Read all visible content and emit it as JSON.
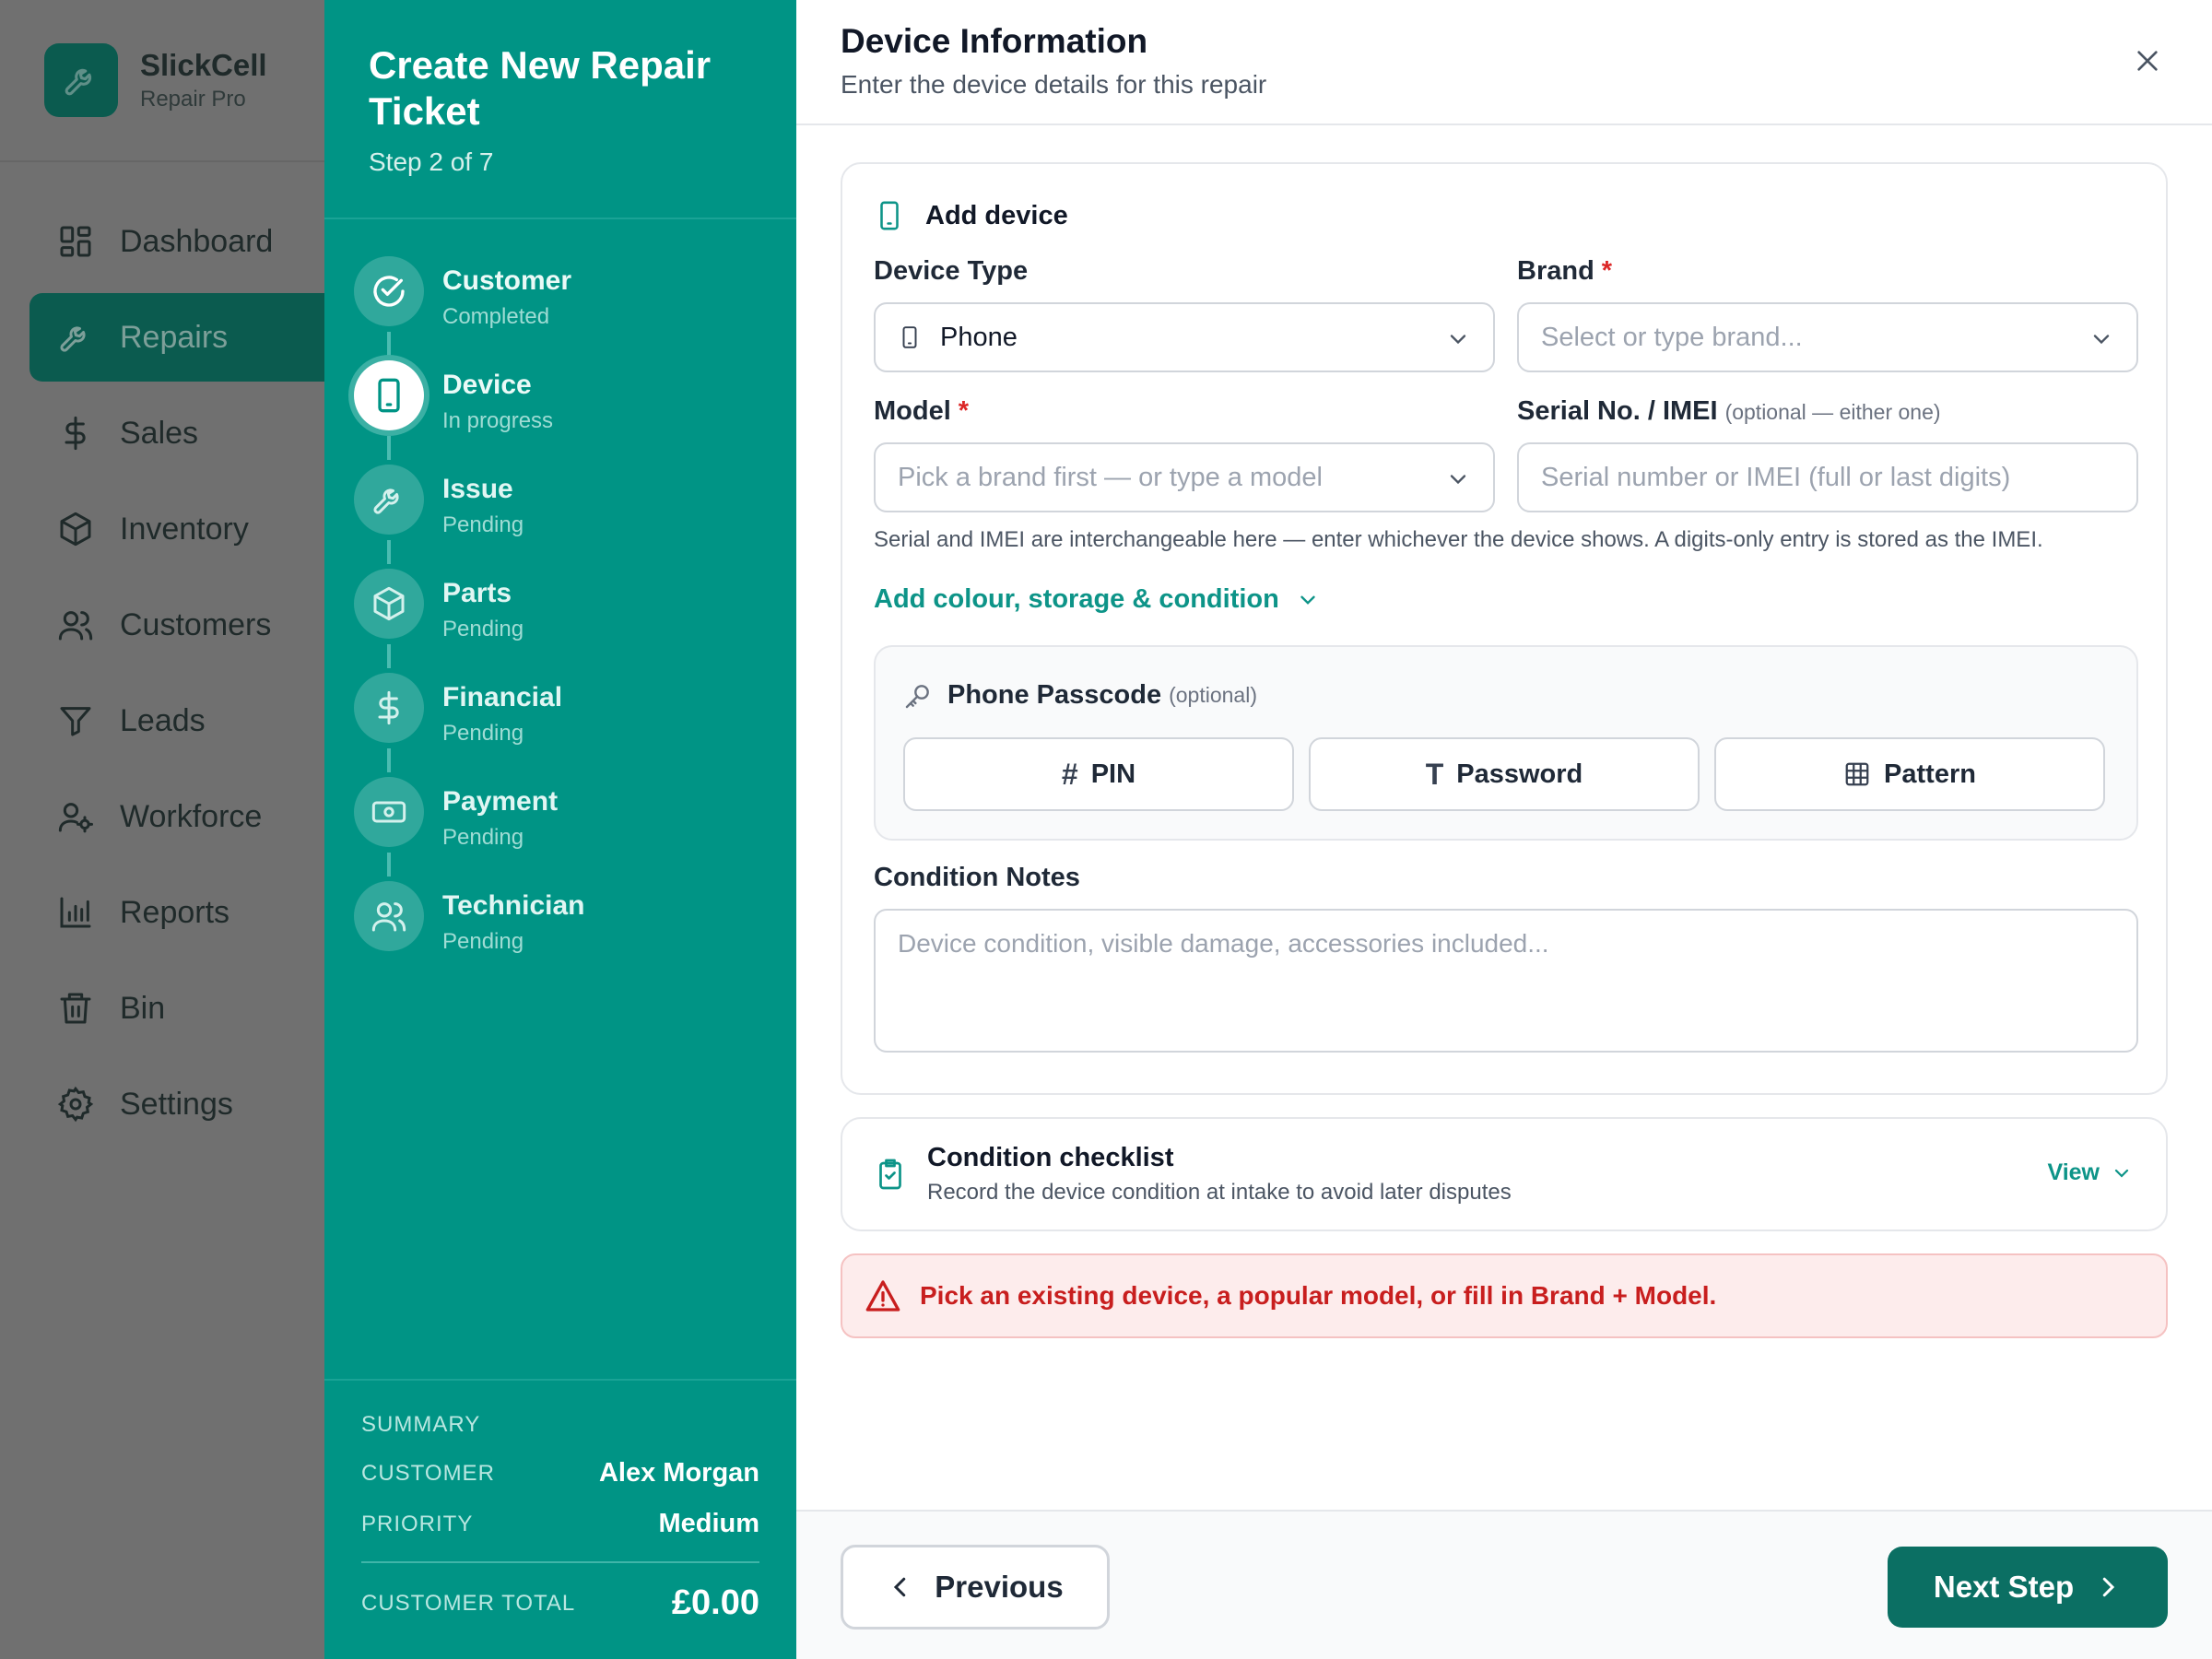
{
  "brand": {
    "name": "SlickCell",
    "subtitle": "Repair Pro"
  },
  "nav": [
    {
      "label": "Dashboard",
      "icon": "dashboard-icon",
      "active": false
    },
    {
      "label": "Repairs",
      "icon": "wrench-icon",
      "active": true
    },
    {
      "label": "Sales",
      "icon": "dollar-icon",
      "active": false
    },
    {
      "label": "Inventory",
      "icon": "box-icon",
      "active": false
    },
    {
      "label": "Customers",
      "icon": "users-icon",
      "active": false
    },
    {
      "label": "Leads",
      "icon": "funnel-icon",
      "active": false
    },
    {
      "label": "Workforce",
      "icon": "user-gear-icon",
      "active": false
    },
    {
      "label": "Reports",
      "icon": "bar-chart-icon",
      "active": false
    },
    {
      "label": "Bin",
      "icon": "trash-icon",
      "active": false
    },
    {
      "label": "Settings",
      "icon": "gear-icon",
      "active": false
    }
  ],
  "wizard": {
    "title": "Create New Repair Ticket",
    "step_text": "Step 2 of 7",
    "steps": [
      {
        "name": "Customer",
        "status": "Completed",
        "icon": "check-circle-icon"
      },
      {
        "name": "Device",
        "status": "In progress",
        "icon": "phone-icon"
      },
      {
        "name": "Issue",
        "status": "Pending",
        "icon": "wrench-icon"
      },
      {
        "name": "Parts",
        "status": "Pending",
        "icon": "box-icon"
      },
      {
        "name": "Financial",
        "status": "Pending",
        "icon": "dollar-icon"
      },
      {
        "name": "Payment",
        "status": "Pending",
        "icon": "cash-icon"
      },
      {
        "name": "Technician",
        "status": "Pending",
        "icon": "users-icon"
      }
    ],
    "summary": {
      "heading": "SUMMARY",
      "customer_label": "CUSTOMER",
      "customer_value": "Alex Morgan",
      "priority_label": "PRIORITY",
      "priority_value": "Medium",
      "total_label": "CUSTOMER TOTAL",
      "total_value": "£0.00"
    }
  },
  "panel": {
    "title": "Device Information",
    "subtitle": "Enter the device details for this repair"
  },
  "device_card": {
    "title": "Add device",
    "device_type_label": "Device Type",
    "device_type_value": "Phone",
    "brand_label": "Brand",
    "brand_required": "*",
    "brand_placeholder": "Select or type brand...",
    "model_label": "Model",
    "model_required": "*",
    "model_placeholder": "Pick a brand first — or type a model",
    "serial_label": "Serial No. / IMEI",
    "serial_optional": "(optional — either one)",
    "serial_placeholder": "Serial number or IMEI (full or last digits)",
    "hint": "Serial and IMEI are interchangeable here — enter whichever the device shows. A digits-only entry is stored as the IMEI.",
    "expander_label": "Add colour, storage & condition",
    "passcode_label": "Phone Passcode",
    "passcode_optional": "(optional)",
    "passcode_pin": "PIN",
    "passcode_password": "Password",
    "passcode_pattern": "Pattern",
    "notes_label": "Condition Notes",
    "notes_placeholder": "Device condition, visible damage, accessories included..."
  },
  "checklist": {
    "title": "Condition checklist",
    "subtitle": "Record the device condition at intake to avoid later disputes",
    "view_label": "View"
  },
  "alert": {
    "message": "Pick an existing device, a popular model, or fill in Brand + Model."
  },
  "footer": {
    "previous_label": "Previous",
    "next_label": "Next Step"
  },
  "colors": {
    "accent": "#009485",
    "accent_dark": "#0b6f63",
    "error": "#c81e1e"
  }
}
